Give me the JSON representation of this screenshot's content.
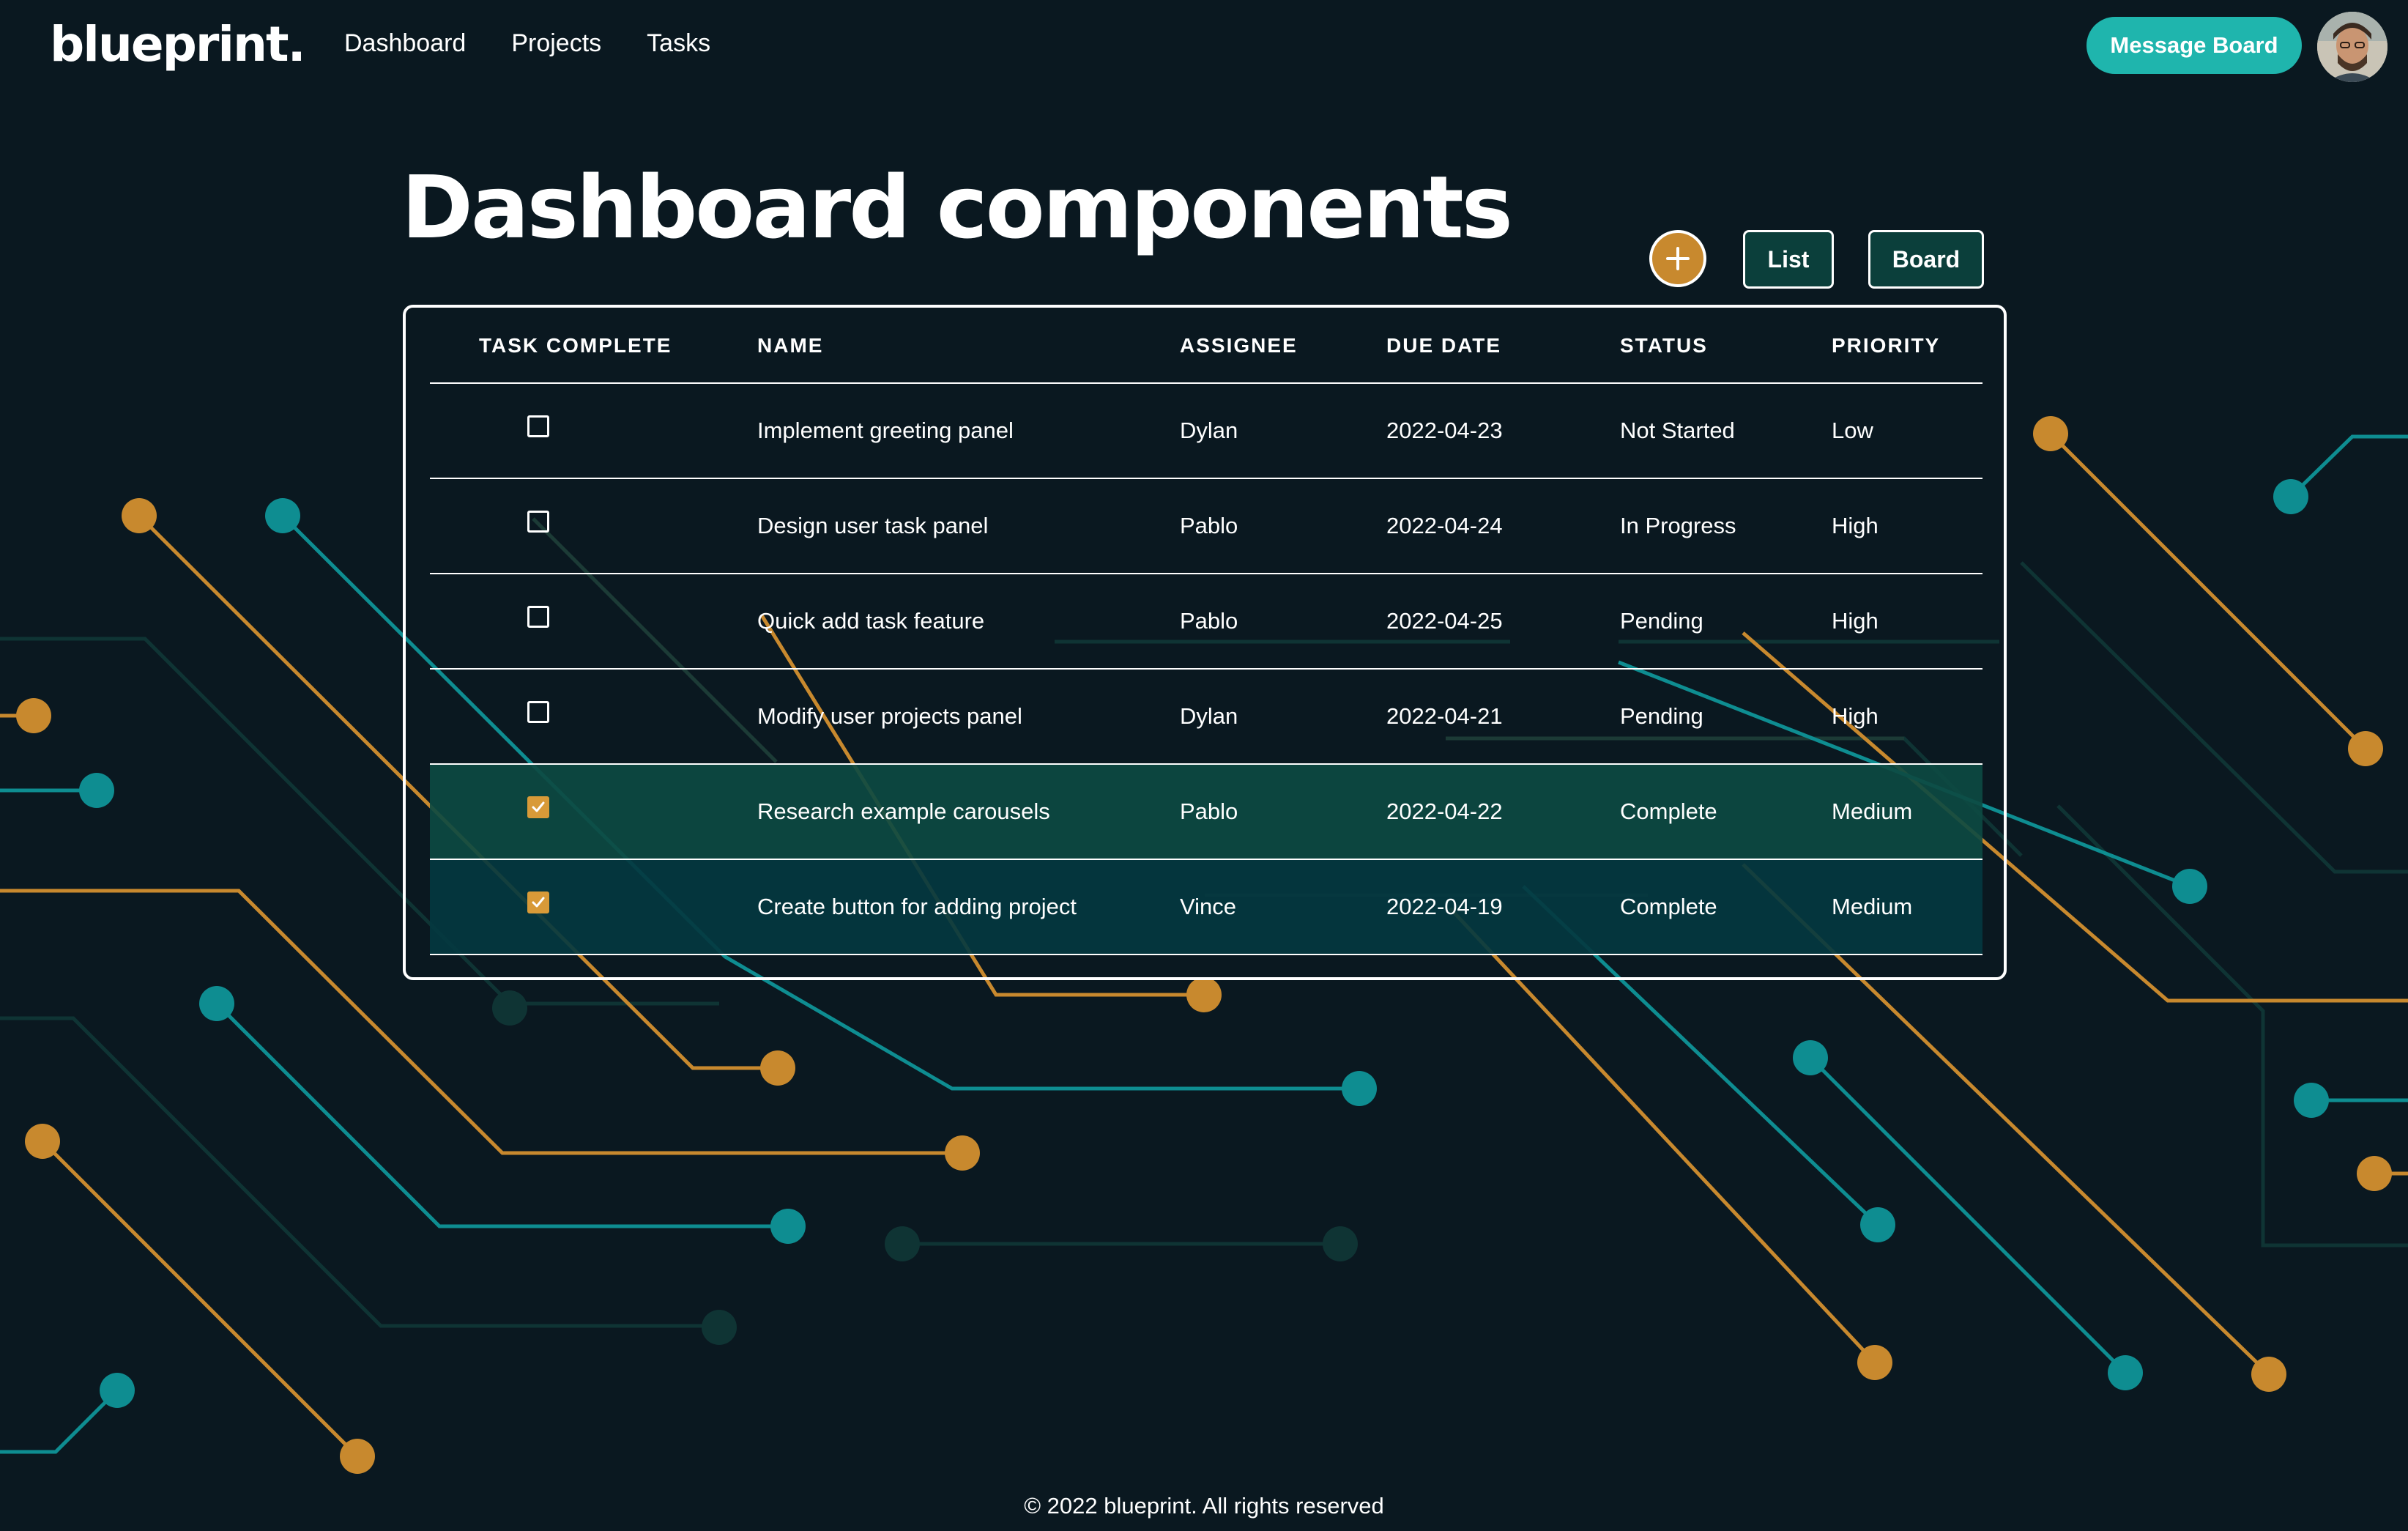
{
  "header": {
    "logo": "blueprint.",
    "nav": [
      "Dashboard",
      "Projects",
      "Tasks"
    ],
    "message_board_label": "Message Board",
    "avatar_alt": "user-avatar"
  },
  "page": {
    "title": "Dashboard components",
    "add_icon": "plus-icon",
    "view_buttons": [
      "List",
      "Board"
    ]
  },
  "table": {
    "columns": [
      "TASK COMPLETE",
      "NAME",
      "ASSIGNEE",
      "DUE DATE",
      "STATUS",
      "PRIORITY"
    ],
    "rows": [
      {
        "complete": false,
        "name": "Implement greeting panel",
        "assignee": "Dylan",
        "due": "2022-04-23",
        "status": "Not Started",
        "priority": "Low"
      },
      {
        "complete": false,
        "name": "Design user task panel",
        "assignee": "Pablo",
        "due": "2022-04-24",
        "status": "In Progress",
        "priority": "High"
      },
      {
        "complete": false,
        "name": "Quick add task feature",
        "assignee": "Pablo",
        "due": "2022-04-25",
        "status": "Pending",
        "priority": "High"
      },
      {
        "complete": false,
        "name": "Modify user projects panel",
        "assignee": "Dylan",
        "due": "2022-04-21",
        "status": "Pending",
        "priority": "High"
      },
      {
        "complete": true,
        "name": "Research example carousels",
        "assignee": "Pablo",
        "due": "2022-04-22",
        "status": "Complete",
        "priority": "Medium"
      },
      {
        "complete": true,
        "name": "Create button for adding project",
        "assignee": "Vince",
        "due": "2022-04-19",
        "status": "Complete",
        "priority": "Medium"
      }
    ]
  },
  "footer": {
    "text": "© 2022 blueprint. All rights reserved"
  },
  "colors": {
    "background": "#0a1820",
    "accent_teal": "#1fb5ad",
    "accent_gold": "#c8892e",
    "row_complete_green": "#0d4a42",
    "row_complete_teal": "#043840"
  }
}
